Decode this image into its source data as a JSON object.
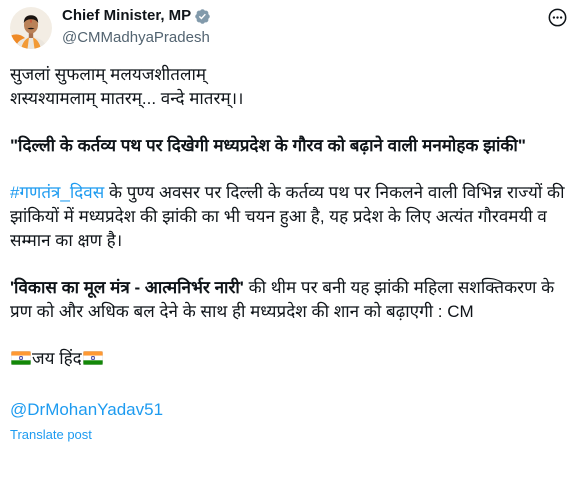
{
  "author": {
    "display_name": "Chief Minister, MP",
    "handle": "@CMMadhyaPradesh"
  },
  "icons": {
    "avatar": "profile-photo",
    "verified": "verified-badge-icon",
    "more": "more-options-icon",
    "flag": "india-flag-icon"
  },
  "body": {
    "intro_lines": [
      "सुजलां सुफलाम् मलयजशीतलाम्",
      "शस्यश्यामलाम् मातरम्... वन्दे मातरम्।।"
    ],
    "headline": "\"दिल्ली के कर्तव्य पथ पर दिखेगी मध्यप्रदेश के गौरव को बढ़ाने वाली मनमोहक झांकी\"",
    "hashtag": "#गणतंत्र_दिवस",
    "para1_rest": " के पुण्य अवसर पर दिल्ली के कर्तव्य पथ पर निकलने वाली विभिन्न राज्यों की झांकियों में मध्यप्रदेश की झांकी का भी चयन हुआ है, यह प्रदेश के लिए अत्यंत गौरवमयी व सम्मान का क्षण है।",
    "theme_quote": "'विकास का मूल मंत्र - आत्मनिर्भर नारी'",
    "para2_rest": " की थीम पर बनी यह झांकी महिला सशक्तिकरण के प्रण को और अधिक बल देने के साथ ही मध्यप्रदेश की शान को बढ़ाएगी : CM",
    "jai_hind": "जय हिंद",
    "mention": "@DrMohanYadav51"
  },
  "translate_label": "Translate post",
  "colors": {
    "text": "#0f1419",
    "secondary": "#536471",
    "link": "#1d9bf0",
    "badge": "#829aab",
    "flag_saffron": "#ff9933",
    "flag_white": "#ffffff",
    "flag_green": "#138808",
    "flag_chakra": "#000080"
  }
}
